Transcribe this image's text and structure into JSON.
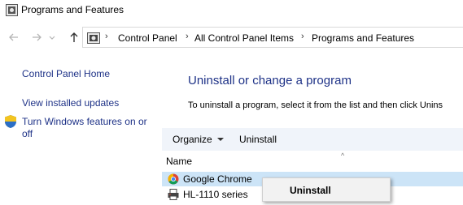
{
  "window": {
    "title": "Programs and Features"
  },
  "nav": {
    "breadcrumb": [
      "Control Panel",
      "All Control Panel Items",
      "Programs and Features"
    ]
  },
  "sidebar": {
    "links": [
      "Control Panel Home",
      "View installed updates",
      "Turn Windows features on or",
      "off"
    ]
  },
  "main": {
    "heading": "Uninstall or change a program",
    "description": "To uninstall a program, select it from the list and then click Unins"
  },
  "toolbar": {
    "organize": "Organize",
    "uninstall": "Uninstall"
  },
  "list": {
    "column": "Name",
    "rows": [
      {
        "label": "Google Chrome",
        "icon": "chrome-icon",
        "selected": true
      },
      {
        "label": "HL-1110 series",
        "icon": "printer-icon",
        "selected": false
      }
    ]
  },
  "context_menu": {
    "items": [
      "Uninstall"
    ]
  },
  "colors": {
    "link": "#1e3287",
    "selection": "#cce4f7",
    "toolbar_bg": "#f0f4fa"
  }
}
